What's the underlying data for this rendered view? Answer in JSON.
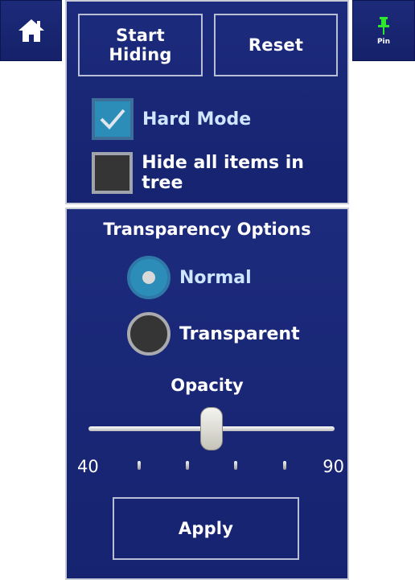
{
  "nav": {
    "home_icon": "home-icon",
    "pin_icon": "pin-icon",
    "pin_label": "Pin",
    "pin_color": "#2ee62e"
  },
  "hide_panel": {
    "start_button": "Start Hiding",
    "reset_button": "Reset",
    "options": [
      {
        "label": "Hard Mode",
        "checked": true
      },
      {
        "label": "Hide all items in tree",
        "checked": false
      }
    ]
  },
  "transparency": {
    "title": "Transparency Options",
    "options": [
      {
        "label": "Normal",
        "selected": true
      },
      {
        "label": "Transparent",
        "selected": false
      }
    ],
    "opacity": {
      "label": "Opacity",
      "min": 40,
      "max": 90,
      "value": 65,
      "min_label": "40",
      "max_label": "90"
    },
    "apply_button": "Apply"
  },
  "colors": {
    "panel_bg": "#1c2a7a",
    "accent": "#2c8db8",
    "text": "#ffffff"
  }
}
